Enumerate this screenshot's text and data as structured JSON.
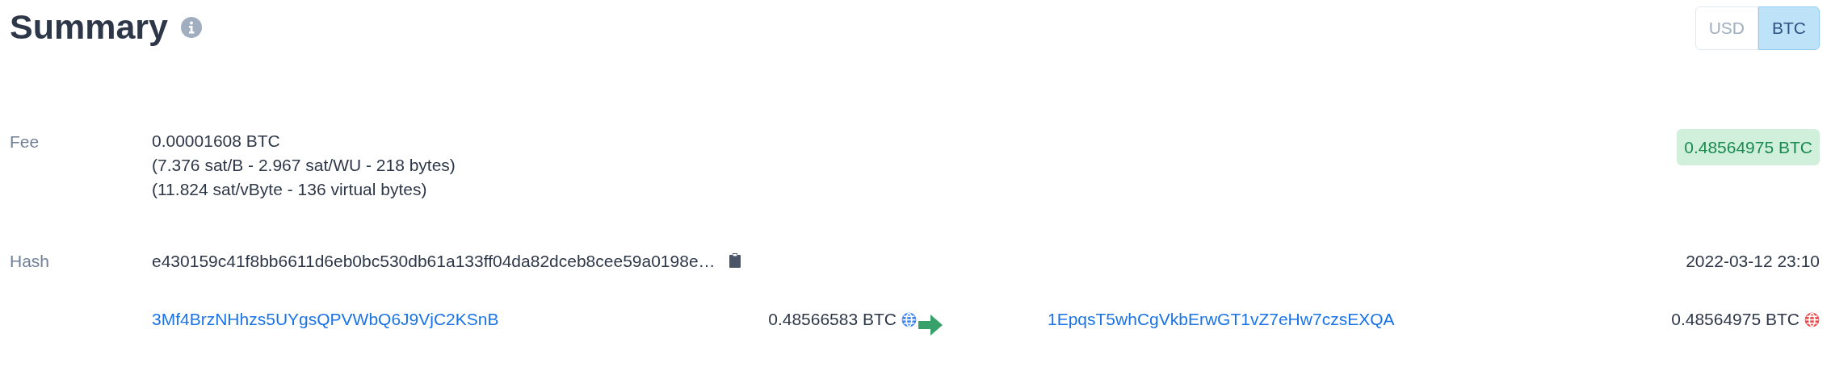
{
  "title": "Summary",
  "currency_toggle": [
    {
      "label": "USD",
      "selected": false
    },
    {
      "label": "BTC",
      "selected": true
    }
  ],
  "fee": {
    "label": "Fee",
    "lines": [
      "0.00001608 BTC",
      "(7.376 sat/B - 2.967 sat/WU - 218 bytes)",
      "(11.824 sat/vByte - 136 virtual bytes)"
    ],
    "total": "0.48564975 BTC"
  },
  "hash": {
    "label": "Hash",
    "value": "e430159c41f8bb6611d6eb0bc530db61a133ff04da82dceb8cee59a0198e…",
    "time": "2022-03-12 23:10"
  },
  "inputs": [
    {
      "address": "3Mf4BrzNHhzs5UYgsQPVWbQ6J9VjC2KSnB",
      "amount": "0.48566583 BTC",
      "color": "#3b82f6"
    }
  ],
  "outputs": [
    {
      "address": "1EpqsT5whCgVkbErwGT1vZ7eHw7czsEXQA",
      "amount": "0.48564975 BTC",
      "color": "#ef4444"
    }
  ]
}
